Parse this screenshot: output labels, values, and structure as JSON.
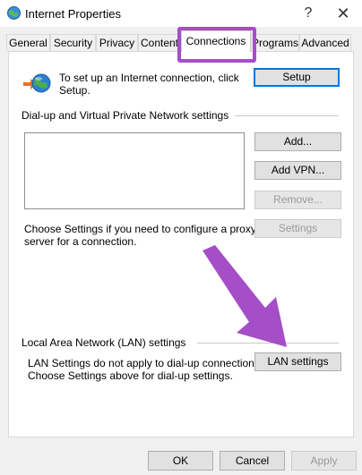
{
  "window": {
    "title": "Internet Properties",
    "help_glyph": "?",
    "close_glyph": "✕"
  },
  "tabs": [
    {
      "label": "General"
    },
    {
      "label": "Security"
    },
    {
      "label": "Privacy"
    },
    {
      "label": "Content"
    },
    {
      "label": "Connections",
      "active": true
    },
    {
      "label": "Programs"
    },
    {
      "label": "Advanced"
    }
  ],
  "setup_section": {
    "text_line1": "To set up an Internet connection, click",
    "text_line2": "Setup.",
    "setup_label": "Setup",
    "icon": "globe-network-icon"
  },
  "dialup_section": {
    "heading": "Dial-up and Virtual Private Network settings",
    "add_label": "Add...",
    "add_vpn_label": "Add VPN...",
    "remove_label": "Remove...",
    "settings_label": "Settings",
    "proxy_text_line1": "Choose Settings if you need to configure a proxy",
    "proxy_text_line2": "server for a connection."
  },
  "lan_section": {
    "heading": "Local Area Network (LAN) settings",
    "text_line1": "LAN Settings do not apply to dial-up connections.",
    "text_line2": "Choose Settings above for dial-up settings.",
    "lan_settings_label": "LAN settings"
  },
  "footer": {
    "ok_label": "OK",
    "cancel_label": "Cancel",
    "apply_label": "Apply"
  },
  "colors": {
    "highlight": "#a54ec8",
    "arrow": "#a54ec8",
    "focus_border": "#0078d7"
  }
}
